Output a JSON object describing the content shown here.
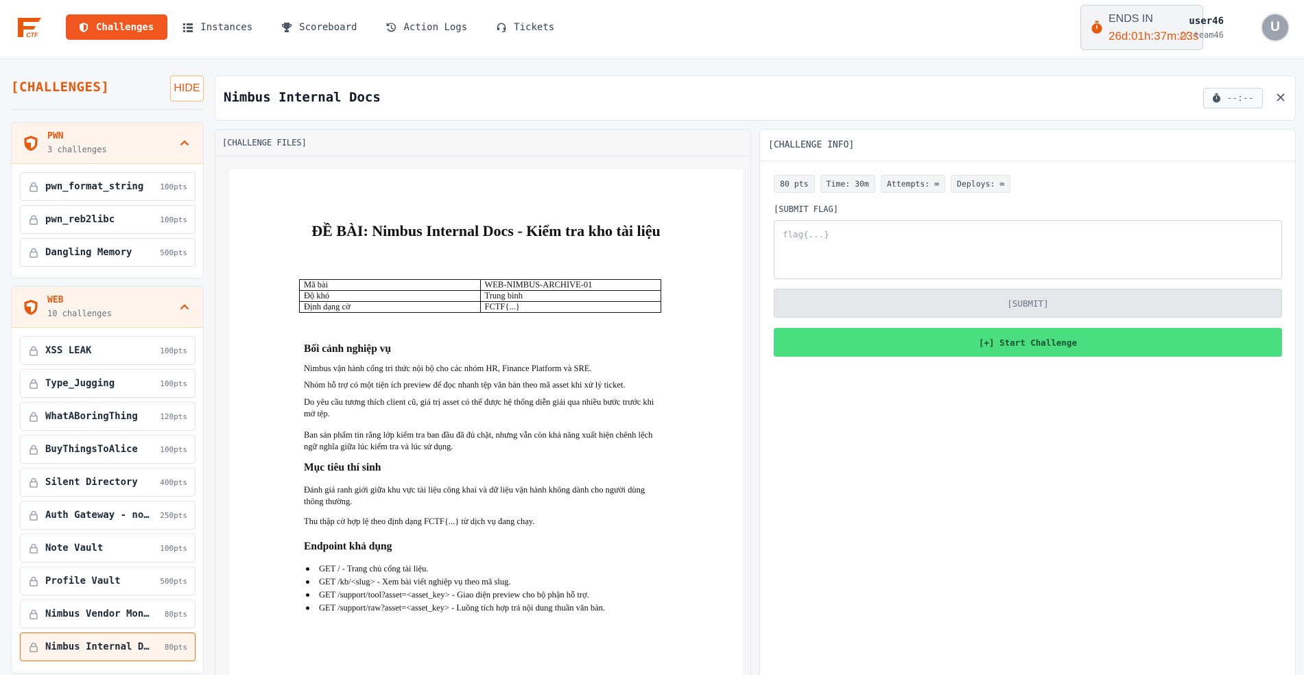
{
  "nav": {
    "items": [
      {
        "label": "Challenges",
        "icon": "shield-icon"
      },
      {
        "label": "Instances",
        "icon": "list-icon"
      },
      {
        "label": "Scoreboard",
        "icon": "trophy-icon"
      },
      {
        "label": "Action Logs",
        "icon": "history-icon"
      },
      {
        "label": "Tickets",
        "icon": "headset-icon"
      }
    ]
  },
  "timer": {
    "label": "ENDS IN",
    "value": "26d:01h:37m:23s"
  },
  "user": {
    "name": "user46",
    "team_prefix": "//",
    "team": "team46",
    "avatar_letter": "U"
  },
  "sidebar": {
    "title": "[CHALLENGES]",
    "hide_label": "HIDE",
    "categories": [
      {
        "name": "PWN",
        "count": "3 challenges",
        "challenges": [
          {
            "name": "pwn_format_string",
            "points": "100pts"
          },
          {
            "name": "pwn_reb2libc",
            "points": "100pts"
          },
          {
            "name": "Dangling Memory",
            "points": "500pts"
          }
        ]
      },
      {
        "name": "WEB",
        "count": "10 challenges",
        "challenges": [
          {
            "name": "XSS LEAK",
            "points": "100pts"
          },
          {
            "name": "Type_Jugging",
            "points": "100pts"
          },
          {
            "name": "WhatABoringThing",
            "points": "120pts"
          },
          {
            "name": "BuyThingsToAlice",
            "points": "100pts"
          },
          {
            "name": "Silent Directory",
            "points": "400pts"
          },
          {
            "name": "Auth Gateway - none…",
            "points": "250pts"
          },
          {
            "name": "Note Vault",
            "points": "100pts"
          },
          {
            "name": "Profile Vault",
            "points": "500pts"
          },
          {
            "name": "Nimbus Vendor Monitor",
            "points": "80pts"
          },
          {
            "name": "Nimbus Internal Docs",
            "points": "80pts"
          }
        ]
      }
    ]
  },
  "main": {
    "title": "Nimbus Internal Docs",
    "timer": "--:--",
    "files_label": "[CHALLENGE FILES]",
    "info_label": "[CHALLENGE INFO]"
  },
  "doc": {
    "title": "ĐỀ BÀI: Nimbus Internal Docs - Kiểm tra kho tài liệu",
    "table": [
      [
        "Mã bài",
        "WEB-NIMBUS-ARCHIVE-01"
      ],
      [
        "Độ khó",
        "Trung bình"
      ],
      [
        "Định dạng cờ",
        "FCTF{...}"
      ]
    ],
    "section1": {
      "heading": "Bối cảnh nghiệp vụ",
      "paragraphs": [
        "Nimbus vận hành cổng tri thức nội bộ cho các nhóm HR, Finance Platform và SRE.",
        "Nhóm hỗ trợ có một tiện ích preview để đọc nhanh tệp văn bản theo mã asset khi xử lý ticket.",
        "Do yêu cầu tương thích client cũ, giá trị asset có thể được hệ thống diễn giải qua nhiều bước trước khi mở tệp.",
        "Ban sản phẩm tin rằng lớp kiểm tra ban đầu đã đủ chặt, nhưng vẫn còn khả năng xuất hiện chênh lệch ngữ nghĩa giữa lúc kiểm tra và lúc sử dụng."
      ]
    },
    "section2": {
      "heading": "Mục tiêu thí sinh",
      "paragraphs": [
        "Đánh giá ranh giới giữa khu vực tài liệu công khai và dữ liệu vận hành không dành cho người dùng thông thường.",
        "Thu thập cờ hợp lệ theo định dạng FCTF{...} từ dịch vụ đang chạy."
      ]
    },
    "section3": {
      "heading": "Endpoint khả dụng",
      "items": [
        "GET / - Trang chủ cổng tài liệu.",
        "GET /kb/<slug> - Xem bài viết nghiệp vụ theo mã slug.",
        "GET /support/tool?asset=<asset_key> - Giao diện preview cho bộ phận hỗ trợ.",
        "GET /support/raw?asset=<asset_key> - Luồng tích hợp trả nội dung thuần văn bản."
      ]
    }
  },
  "info": {
    "chips": [
      "80 pts",
      "Time: 30m",
      "Attempts: ∞",
      "Deploys: ∞"
    ],
    "submit_label": "[SUBMIT FLAG]",
    "flag_placeholder": "flag{...}",
    "submit_button": "[SUBMIT]",
    "start_button": "[+] Start Challenge"
  },
  "colors": {
    "accent": "#f0561d",
    "start": "#4ade80",
    "category_bg": "#fff4ec"
  }
}
